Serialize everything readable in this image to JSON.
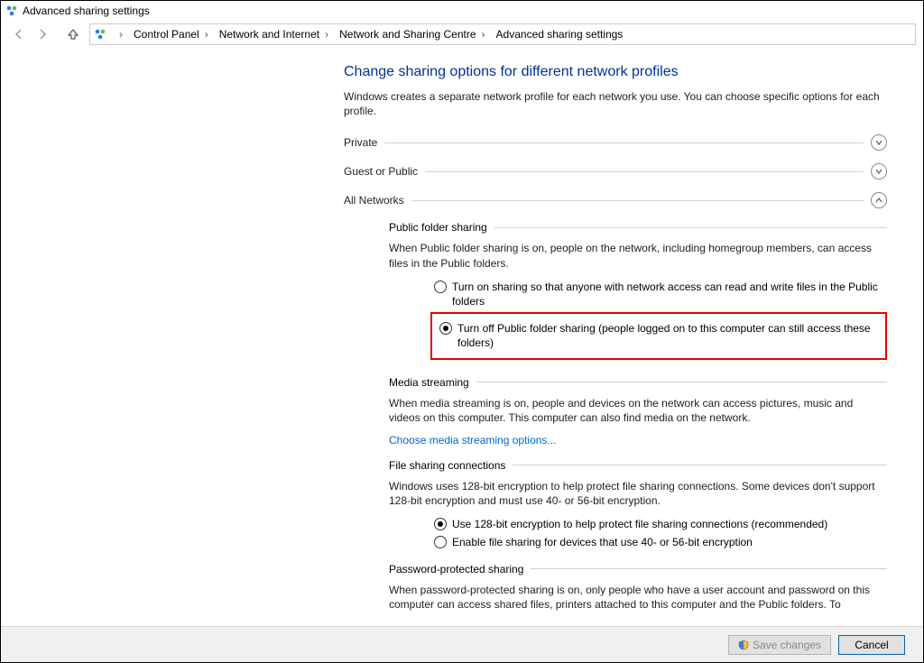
{
  "window": {
    "title": "Advanced sharing settings"
  },
  "breadcrumb": {
    "items": [
      {
        "label": "Control Panel"
      },
      {
        "label": "Network and Internet"
      },
      {
        "label": "Network and Sharing Centre"
      },
      {
        "label": "Advanced sharing settings"
      }
    ]
  },
  "page": {
    "heading": "Change sharing options for different network profiles",
    "intro": "Windows creates a separate network profile for each network you use. You can choose specific options for each profile."
  },
  "profiles": {
    "private": {
      "label": "Private"
    },
    "guest": {
      "label": "Guest or Public"
    },
    "all": {
      "label": "All Networks"
    }
  },
  "public_folder": {
    "title": "Public folder sharing",
    "desc": "When Public folder sharing is on, people on the network, including homegroup members, can access files in the Public folders.",
    "opt_on": "Turn on sharing so that anyone with network access can read and write files in the Public folders",
    "opt_off": "Turn off Public folder sharing (people logged on to this computer can still access these folders)"
  },
  "media": {
    "title": "Media streaming",
    "desc": "When media streaming is on, people and devices on the network can access pictures, music and videos on this computer. This computer can also find media on the network.",
    "link": "Choose media streaming options..."
  },
  "fileshare": {
    "title": "File sharing connections",
    "desc": "Windows uses 128-bit encryption to help protect file sharing connections. Some devices don't support 128-bit encryption and must use 40- or 56-bit encryption.",
    "opt_128": "Use 128-bit encryption to help protect file sharing connections (recommended)",
    "opt_40": "Enable file sharing for devices that use 40- or 56-bit encryption"
  },
  "password": {
    "title": "Password-protected sharing",
    "desc": "When password-protected sharing is on, only people who have a user account and password on this computer can access shared files, printers attached to this computer and the Public folders. To"
  },
  "footer": {
    "save_label": "Save changes",
    "cancel_label": "Cancel"
  }
}
